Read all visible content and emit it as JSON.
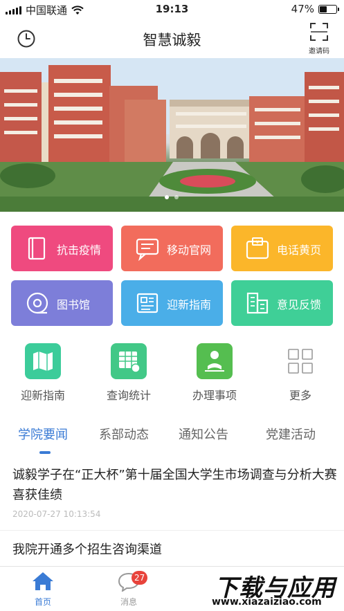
{
  "status_bar": {
    "carrier": "中国联通",
    "time": "19:13",
    "battery": "47%",
    "battery_level": 0.47
  },
  "navbar": {
    "title": "智慧诚毅",
    "invite_label": "邀请码"
  },
  "banner": {
    "dots": 2,
    "active_dot": 1
  },
  "tiles": [
    {
      "label": "抗击疫情",
      "color": "#ef4a7f",
      "icon": "book-icon"
    },
    {
      "label": "移动官网",
      "color": "#f26c5c",
      "icon": "chat-icon"
    },
    {
      "label": "电话黄页",
      "color": "#fbb62a",
      "icon": "wallet-icon"
    },
    {
      "label": "图书馆",
      "color": "#7d7ed9",
      "icon": "disc-icon"
    },
    {
      "label": "迎新指南",
      "color": "#4aaee8",
      "icon": "document-icon"
    },
    {
      "label": "意见反馈",
      "color": "#3fcf97",
      "icon": "building-icon"
    }
  ],
  "quick": [
    {
      "label": "迎新指南",
      "color": "#3ccc9a",
      "icon": "map-icon"
    },
    {
      "label": "查询统计",
      "color": "#42c887",
      "icon": "table-icon"
    },
    {
      "label": "办理事项",
      "color": "#55be50",
      "icon": "reader-icon"
    },
    {
      "label": "更多",
      "color": "#ffffff",
      "icon": "grid-icon"
    }
  ],
  "tabs": [
    {
      "label": "学院要闻",
      "active": true
    },
    {
      "label": "系部动态",
      "active": false
    },
    {
      "label": "通知公告",
      "active": false
    },
    {
      "label": "党建活动",
      "active": false
    }
  ],
  "news": [
    {
      "title": "诚毅学子在“正大杯”第十届全国大学生市场调查与分析大赛喜获佳绩",
      "time": "2020-07-27 10:13:54"
    },
    {
      "title": "我院开通多个招生咨询渠道",
      "time": ""
    }
  ],
  "tabbar": [
    {
      "label": "首页",
      "active": true,
      "icon": "home-icon"
    },
    {
      "label": "消息",
      "active": false,
      "icon": "message-icon",
      "badge": "27"
    }
  ],
  "watermark": {
    "main": "下载与应用",
    "url": "www.xiazaiziao.com"
  },
  "colors": {
    "accent": "#3a7bd5",
    "badge": "#e8433b"
  }
}
